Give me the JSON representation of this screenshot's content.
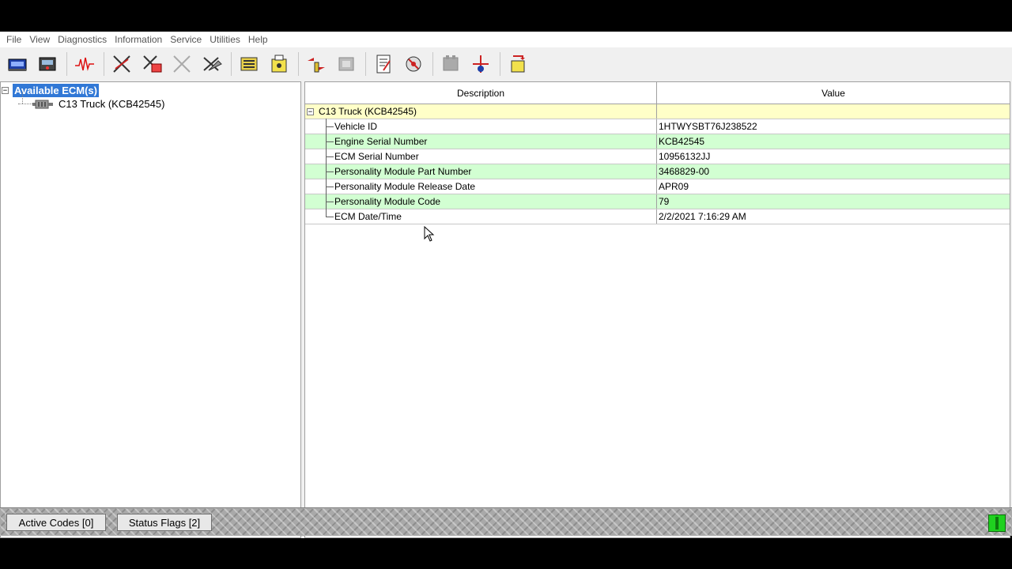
{
  "menu": [
    "File",
    "View",
    "Diagnostics",
    "Information",
    "Service",
    "Utilities",
    "Help"
  ],
  "toolbar": {
    "icons": [
      "connect-icon",
      "disconnect-icon",
      "status-waveform-icon",
      "active-codes-icon",
      "logged-codes-icon",
      "events-icon",
      "clear-codes-icon",
      "configuration-icon",
      "ecm-summary-icon",
      "tests-icon",
      "calibrations-icon",
      "document-icon",
      "flash-icon",
      "graph-icon",
      "data-link-icon",
      "flash-file-icon"
    ]
  },
  "tree": {
    "root_label": "Available ECM(s)",
    "child_label": "C13 Truck (KCB42545)"
  },
  "grid": {
    "headers": {
      "description": "Description",
      "value": "Value"
    },
    "group_label": "C13 Truck (KCB42545)",
    "rows": [
      {
        "description": "Vehicle ID",
        "value": "1HTWYSBT76J238522"
      },
      {
        "description": "Engine Serial Number",
        "value": "KCB42545"
      },
      {
        "description": "ECM Serial Number",
        "value": "10956132JJ"
      },
      {
        "description": "Personality Module Part Number",
        "value": "3468829-00"
      },
      {
        "description": "Personality Module Release Date",
        "value": "APR09"
      },
      {
        "description": "Personality Module Code",
        "value": "79"
      },
      {
        "description": "ECM Date/Time",
        "value": "2/2/2021 7:16:29 AM"
      }
    ]
  },
  "statusbar": {
    "active_codes": "Active Codes [0]",
    "status_flags": "Status Flags [2]"
  },
  "colors": {
    "selection": "#3178d6",
    "group_row": "#ffffc8",
    "alt_row": "#d2ffd2",
    "connection_light": "#1fd11f"
  }
}
